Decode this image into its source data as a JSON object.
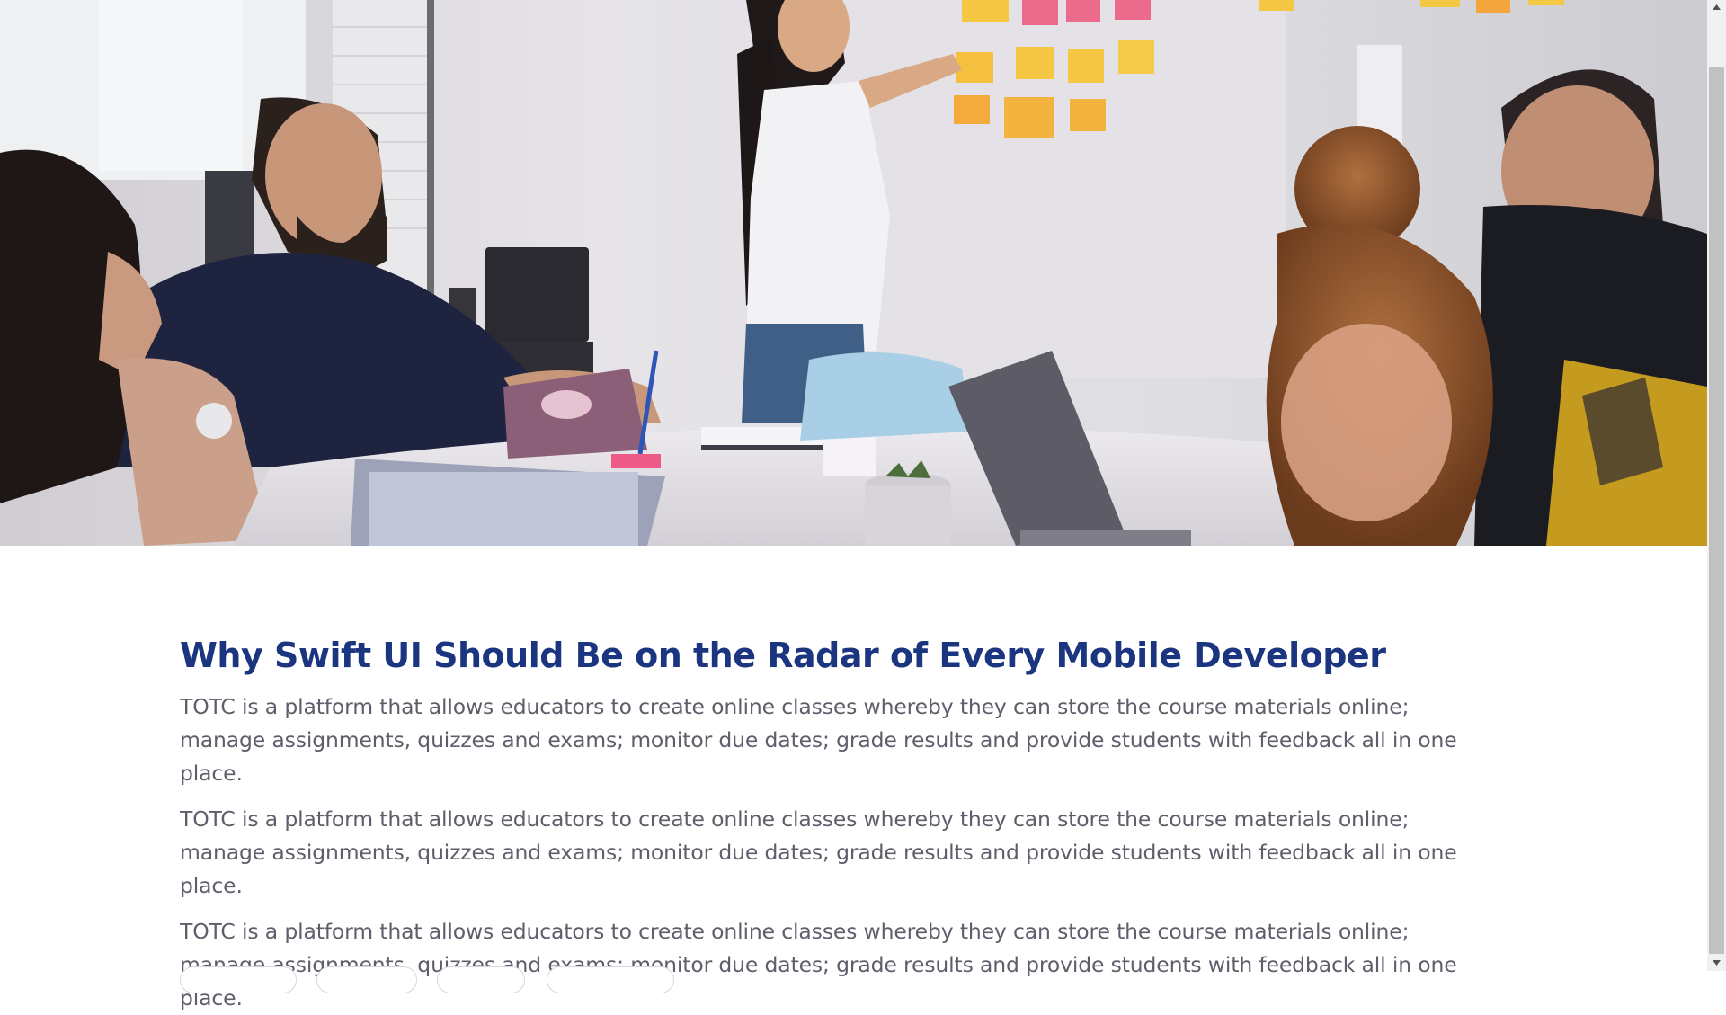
{
  "hero": {
    "image_name": "team-meeting-sticky-notes-photo"
  },
  "article": {
    "title": "Why Swift UI Should Be on the Radar of Every Mobile Developer",
    "paragraphs": [
      "TOTC is a platform that allows educators to create online classes whereby they can store the course materials online; manage assignments, quizzes and exams; monitor due dates; grade results and provide students with feedback all in one place.",
      "TOTC is a platform that allows educators to create online classes whereby they can store the course materials online; manage assignments, quizzes and exams; monitor due dates; grade results and provide students with feedback all in one place.",
      "TOTC is a platform that allows educators to create online classes whereby they can store the course materials online; manage assignments, quizzes and exams; monitor due dates; grade results and provide students with feedback all in one place."
    ]
  },
  "colors": {
    "title": "#1b3580",
    "body_text": "#5d5f6a",
    "tag_border": "#d6d7dc",
    "scrollbar_track": "#f1f1f1",
    "scrollbar_thumb": "#c1c1c1"
  },
  "icons": {
    "scroll_up": "triangle-up-icon",
    "scroll_down": "triangle-down-icon"
  }
}
